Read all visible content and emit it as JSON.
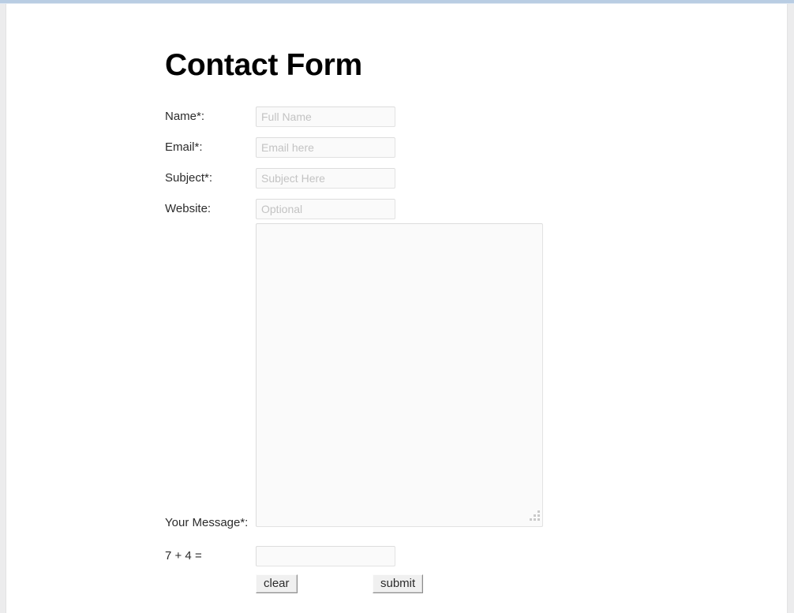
{
  "page": {
    "title": "Contact Form"
  },
  "form": {
    "fields": [
      {
        "id": "name",
        "label": "Name*:",
        "placeholder": "Full Name",
        "value": ""
      },
      {
        "id": "email",
        "label": "Email*:",
        "placeholder": "Email here",
        "value": ""
      },
      {
        "id": "subject",
        "label": "Subject*:",
        "placeholder": "Subject Here",
        "value": ""
      },
      {
        "id": "website",
        "label": "Website:",
        "placeholder": "Optional",
        "value": ""
      }
    ],
    "message": {
      "label": "Your Message*:",
      "placeholder": "",
      "value": ""
    },
    "captcha": {
      "label": "7 + 4 =",
      "placeholder": "",
      "value": ""
    },
    "buttons": {
      "clear": "clear",
      "submit": "submit"
    }
  },
  "colors": {
    "top_rule": "#b9cde3",
    "input_border": "#e2e2e2",
    "input_background": "#fafafa",
    "placeholder_text": "#c3c3c3",
    "label_text": "#2b2b2b",
    "button_face": "#f0f0f0",
    "button_shadow": "#8c8c8c"
  }
}
